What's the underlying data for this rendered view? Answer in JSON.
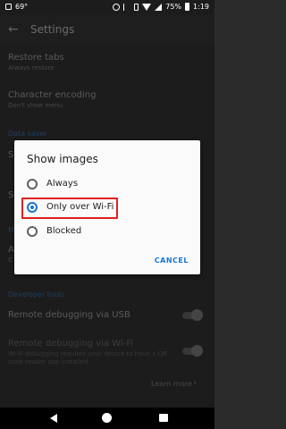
{
  "status": {
    "temp": "69°",
    "battery": "75%",
    "time": "1:19"
  },
  "appbar": {
    "title": "Settings",
    "back_icon": "arrow-back-icon"
  },
  "settings": {
    "restore_tabs": {
      "title": "Restore tabs",
      "subtitle": "Always restore"
    },
    "char_encoding": {
      "title": "Character encoding",
      "subtitle": "Don't show menu"
    },
    "section_data_saver": "Data saver",
    "partial_s1": "S",
    "partial_s2": "S",
    "section_partial": "M",
    "partial_a": "A",
    "partial_c": "C",
    "section_dev": "Developer tools",
    "remote_usb": {
      "title": "Remote debugging via USB"
    },
    "remote_wifi": {
      "title": "Remote debugging via Wi-Fi",
      "subtitle1": "Wi-Fi debugging requires your device to have a QR",
      "subtitle2": "code reader app installed."
    },
    "learn_more": "Learn more"
  },
  "dialog": {
    "title": "Show images",
    "options": [
      "Always",
      "Only over Wi-Fi",
      "Blocked"
    ],
    "selected_index": 1,
    "cancel": "CANCEL"
  },
  "colors": {
    "accent": "#1976d2",
    "highlight": "#e02020"
  }
}
